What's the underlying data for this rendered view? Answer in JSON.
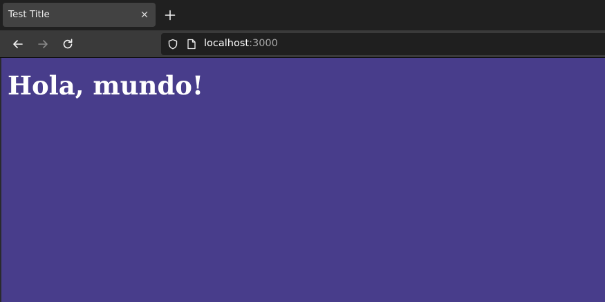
{
  "browser": {
    "tab": {
      "title": "Test Title"
    },
    "icons": {
      "tab_close": "close-icon",
      "new_tab": "plus-icon",
      "back": "arrow-left-icon",
      "forward": "arrow-right-icon",
      "reload": "reload-icon",
      "site_info": "shield-icon",
      "page": "page-icon"
    },
    "url": {
      "host": "localhost",
      "port": ":3000"
    }
  },
  "page": {
    "heading": "Hola, mundo!",
    "background_color": "#483d8b",
    "text_color": "#ffffff"
  }
}
